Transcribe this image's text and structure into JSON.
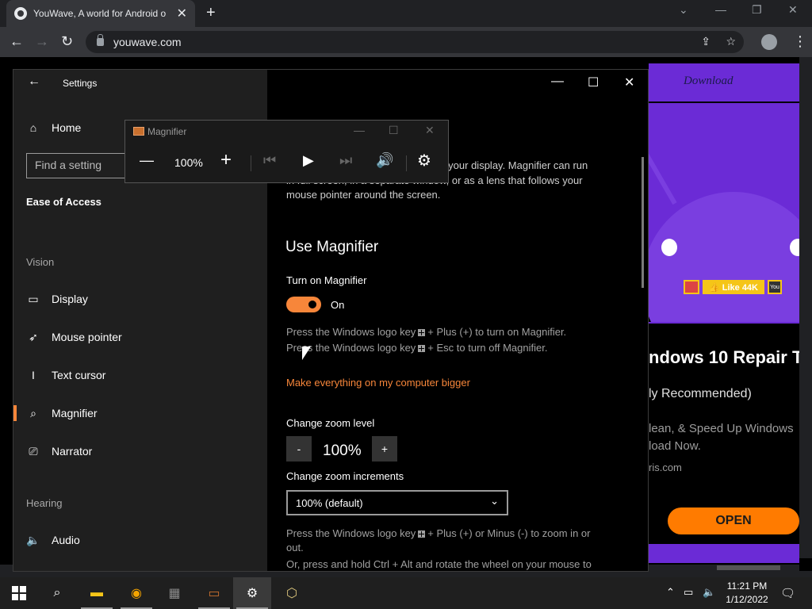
{
  "browser": {
    "tab_title": "YouWave, A world for Android o",
    "tab_close": "✕",
    "new_tab": "+",
    "url": "youwave.com"
  },
  "webpage": {
    "download": "Download",
    "like": "👍 Like 44K",
    "like_e": "E",
    "yt": "You",
    "repair_title": "ndows 10 Repair T",
    "repair_sub": "ly Recommended)",
    "repair_desc_1": "lean, & Speed Up Windows",
    "repair_desc_2": "load Now.",
    "repair_url": "ris.com",
    "open_button": "OPEN"
  },
  "settings": {
    "window_title": "Settings",
    "nav": {
      "home": "Home",
      "search_placeholder": "Find a setting",
      "category": "Ease of Access",
      "vision_header": "Vision",
      "display": "Display",
      "mouse_pointer": "Mouse pointer",
      "text_cursor": "Text cursor",
      "magnifier": "Magnifier",
      "narrator": "Narrator",
      "hearing_header": "Hearing",
      "audio": "Audio"
    },
    "content": {
      "intro_partial_1": "ts of your display. Magnifier can run",
      "intro_partial_2": "in full screen, in a separate window, or as a lens that follows your",
      "intro_partial_3": "mouse pointer around the screen.",
      "use_magnifier_heading": "Use Magnifier",
      "turn_on_label": "Turn on Magnifier",
      "toggle_state": "On",
      "hint_on_a": "Press the Windows logo key",
      "hint_on_b": "+ Plus (+) to turn on Magnifier.",
      "hint_off_a": "Press the Windows logo key",
      "hint_off_b": "+ Esc to turn off Magnifier.",
      "link_bigger": "Make everything on my computer bigger",
      "zoom_level_label": "Change zoom level",
      "zoom_minus": "-",
      "zoom_value": "100%",
      "zoom_plus": "+",
      "zoom_increments_label": "Change zoom increments",
      "increments_selected": "100% (default)",
      "zoom_hint_a": "Press the Windows logo key",
      "zoom_hint_b": "+ Plus (+) or Minus (-) to zoom in or",
      "zoom_hint_c": "out.",
      "zoom_hint_d": "Or, press and hold Ctrl + Alt and rotate the wheel on your mouse to"
    }
  },
  "magnifier": {
    "title": "Magnifier",
    "zoom": "100%"
  },
  "taskbar": {
    "time": "11:21 PM",
    "date": "1/12/2022"
  },
  "colors": {
    "accent": "#f7863a",
    "chrome_dark": "#202124",
    "purple": "#6b2bd6"
  }
}
